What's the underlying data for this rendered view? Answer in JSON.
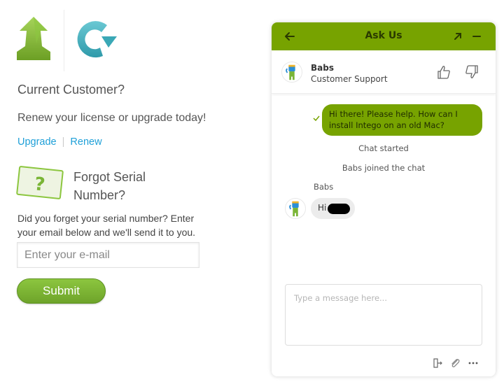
{
  "left_panel": {
    "logos": [
      "upgrade-arrow-logo",
      "renew-circle-logo"
    ],
    "current_customer": {
      "heading": "Current Customer?",
      "text": "Renew your license or upgrade today!",
      "links": {
        "upgrade": "Upgrade",
        "separator": "|",
        "renew": "Renew"
      }
    },
    "forgot_serial": {
      "heading": "Forgot Serial Number?",
      "text": "Did you forget your serial number? Enter your email below and we'll send it to you.",
      "email_placeholder": "Enter your e-mail",
      "email_value": "",
      "submit_label": "Submit"
    }
  },
  "chat": {
    "header": {
      "title": "Ask Us",
      "icons": [
        "back-arrow-icon",
        "popout-icon",
        "minimize-icon"
      ]
    },
    "agent": {
      "name": "Babs",
      "role": "Customer Support"
    },
    "messages": [
      {
        "type": "outgoing",
        "text": "Hi there! Please help. How can I install Intego on an old Mac?",
        "status": "sent"
      },
      {
        "type": "system",
        "text": "Chat started"
      },
      {
        "type": "system",
        "text": "Babs joined the chat"
      },
      {
        "type": "incoming",
        "sender": "Babs",
        "text": "Hi"
      }
    ],
    "compose": {
      "placeholder": "Type a message here...",
      "value": ""
    },
    "toolbar": [
      "end-chat-icon",
      "attach-icon",
      "more-icon"
    ]
  },
  "colors": {
    "chat_accent": "#77a300",
    "link": "#1fa0d8",
    "submit_green": "#7ab536"
  }
}
